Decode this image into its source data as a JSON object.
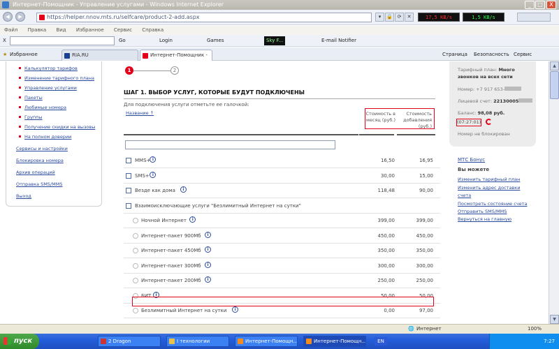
{
  "window": {
    "title": "Интернет-Помощник - Управление услугами - Windows Internet Explorer",
    "min": "_",
    "max": "□",
    "close": "X"
  },
  "address": {
    "url": "https://helper.nnov.mts.ru/selfcare/product-2-add.aspx"
  },
  "speed": {
    "down": "17,5 KB/s",
    "up": "1,5 KB/s"
  },
  "menu": [
    "Файл",
    "Правка",
    "Вид",
    "Избранное",
    "Сервис",
    "Справка"
  ],
  "toolbar2": {
    "go": "Go",
    "login": "Login",
    "games": "Games",
    "skyfi": "Sky F...",
    "email": "E-mail Notifier"
  },
  "favbar": {
    "favorites": "Избранное",
    "tab1": "RIA.RU",
    "tab2": "Интернет-Помощник - У...",
    "page": "Страница",
    "security": "Безопасность",
    "service": "Сервис"
  },
  "leftnav": {
    "sub": [
      "Калькулятор тарифов",
      "Изменение тарифного плана",
      "Управление услугами",
      "Пакеты",
      "Любимые номера",
      "Группы",
      "Получение скидки на вызовы",
      "На полном доверии"
    ],
    "main": [
      "Сервисы и настройки",
      "Блокировка номера",
      "Архив операций",
      "Отправка SMS/MMS",
      "Выход"
    ]
  },
  "steps": {
    "one": "1",
    "two": "2",
    "title": "ШАГ 1. ВЫБОР УСЛУГ, КОТОРЫЕ БУДУТ ПОДКЛЮЧЕНЫ"
  },
  "form": {
    "hint": "Для подключения услуги отметьте ее галочкой:",
    "sort": "Название ↑",
    "col1": "Стоимость в месяц (руб.)",
    "col2": "Стоимость добавления (руб.)"
  },
  "services": [
    {
      "name": "MMS+",
      "monthly": "16,50",
      "add": "16,95",
      "kind": "checkbox",
      "info": true
    },
    {
      "name": "SMS+",
      "monthly": "30,00",
      "add": "15,00",
      "kind": "checkbox",
      "info": true
    },
    {
      "name": "Везде как дома",
      "monthly": "118,48",
      "add": "90,00",
      "kind": "checkbox",
      "info": true
    },
    {
      "name": "Взаимоисключающие услуги \"Безлимитный Интернет на сутки\"",
      "monthly": "",
      "add": "",
      "kind": "checkbox",
      "info": false
    },
    {
      "name": "Ночной Интернет",
      "monthly": "399,00",
      "add": "399,00",
      "kind": "radio",
      "info": true
    },
    {
      "name": "Интернет-пакет 900Мб",
      "monthly": "450,00",
      "add": "450,00",
      "kind": "radio",
      "info": true
    },
    {
      "name": "Интернет-пакет 450Мб",
      "monthly": "350,00",
      "add": "350,00",
      "kind": "radio",
      "info": true
    },
    {
      "name": "Интернет-пакет 300Мб",
      "monthly": "300,00",
      "add": "300,00",
      "kind": "radio",
      "info": true
    },
    {
      "name": "Интернет-пакет 200Мб",
      "monthly": "250,00",
      "add": "250,00",
      "kind": "radio",
      "info": true
    },
    {
      "name": "БИТ",
      "monthly": "50,00",
      "add": "50,00",
      "kind": "radio",
      "info": true
    },
    {
      "name": "Безлимитный Интернет на сутки",
      "monthly": "0,00",
      "add": "97,00",
      "kind": "radio",
      "info": true
    }
  ],
  "account": {
    "plan_label": "Тарифный план:",
    "plan_value": "Много",
    "plan_value2": "звонков на всех сети",
    "number_label": "Номер:",
    "number_value": "+7 917 653-",
    "account_label": "Лицевой счет:",
    "account_value": "22130005",
    "balance_label": "Баланс:",
    "balance_value": "98,08 руб.",
    "time": "(07:27:01)",
    "status": "Номер не блокирован"
  },
  "bonus": {
    "title": "МТС Бонус",
    "can": "Вы можете",
    "links": [
      "Изменить тарифный план",
      "Изменить адрес доставки",
      "счета",
      "Посмотреть состояние счета",
      "Отправить SMS/MMS",
      "Вернуться на главную"
    ]
  },
  "status": {
    "zone": "Интернет",
    "zoom": "100%"
  },
  "taskbar": {
    "start": "пуск",
    "tasks": [
      "2 Dragon",
      "I технологии",
      "Интернет-Помощн...",
      "Интернет-Помощн...",
      "Интернет-Помощн..."
    ],
    "lang": "EN",
    "clock": "7:27"
  }
}
